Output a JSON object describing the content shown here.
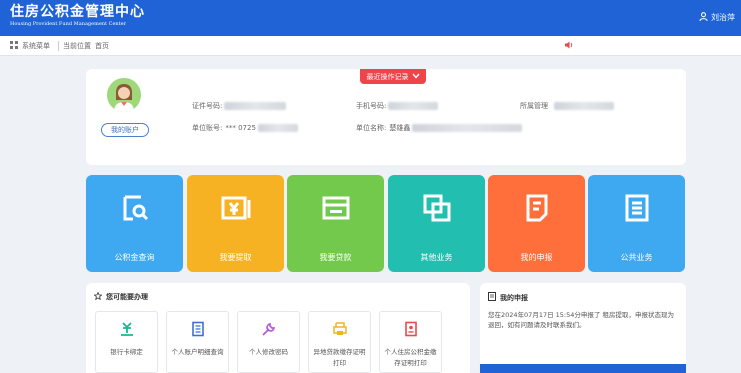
{
  "header": {
    "title_cn": "住房公积金管理中心",
    "title_en": "Housing Provident Fund Management Center",
    "user_name": "刘治萍"
  },
  "toolbar": {
    "menu_label": "系统菜单",
    "location_label": "当前位置",
    "home_label": "首页"
  },
  "profile": {
    "recent_button": "最近操作记录",
    "my_account": "我的账户",
    "id_label": "证件号码:",
    "phone_label": "手机号码:",
    "manager_label": "所属管理",
    "unit_account_label": "单位账号:",
    "unit_account_visible": "*** 0725",
    "unit_name_label": "单位名称:",
    "unit_name_visible": "楚雄鑫"
  },
  "tiles": [
    {
      "label": "公积金查询",
      "color": "#3ea8f0",
      "icon": "search-doc-icon"
    },
    {
      "label": "我要提取",
      "color": "#f7b223",
      "icon": "withdraw-icon"
    },
    {
      "label": "我要贷款",
      "color": "#72c94c",
      "icon": "loan-icon"
    },
    {
      "label": "其他业务",
      "color": "#22bfb1",
      "icon": "other-business-icon"
    },
    {
      "label": "我的申报",
      "color": "#ff6f3c",
      "icon": "my-declaration-icon"
    },
    {
      "label": "公共业务",
      "color": "#3ea8f0",
      "icon": "public-business-icon"
    }
  ],
  "services": {
    "title": "您可能要办理",
    "items": [
      {
        "label": "银行卡绑定",
        "icon": "bank-card-icon",
        "color": "#1fb58f"
      },
      {
        "label": "个人账户明细查询",
        "icon": "account-detail-icon",
        "color": "#3f6fd6"
      },
      {
        "label": "个人修改密码",
        "icon": "wrench-icon",
        "color": "#b55bd9"
      },
      {
        "label": "异地贷款缴存证明打印",
        "icon": "print-icon",
        "color": "#f2b320"
      },
      {
        "label": "个人住房公积金缴存证明打印",
        "icon": "certificate-icon",
        "color": "#e84a4a"
      }
    ]
  },
  "declaration": {
    "title": "我的申报",
    "text": "您在2024年07月17日 15:54分申报了 租房提取，申报状态现为退回，如有问题请及时联系我们。"
  }
}
